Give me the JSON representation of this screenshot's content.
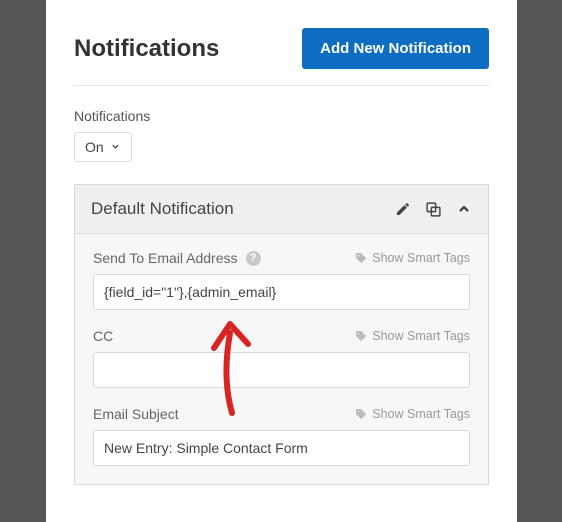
{
  "header": {
    "title": "Notifications",
    "add_button": "Add New Notification"
  },
  "toggle": {
    "label": "Notifications",
    "value": "On"
  },
  "card": {
    "title": "Default Notification",
    "smart_tags_label": "Show Smart Tags",
    "fields": {
      "send_to": {
        "label": "Send To Email Address",
        "value": "{field_id=\"1\"},{admin_email}"
      },
      "cc": {
        "label": "CC",
        "value": ""
      },
      "subject": {
        "label": "Email Subject",
        "value": "New Entry: Simple Contact Form"
      }
    }
  }
}
